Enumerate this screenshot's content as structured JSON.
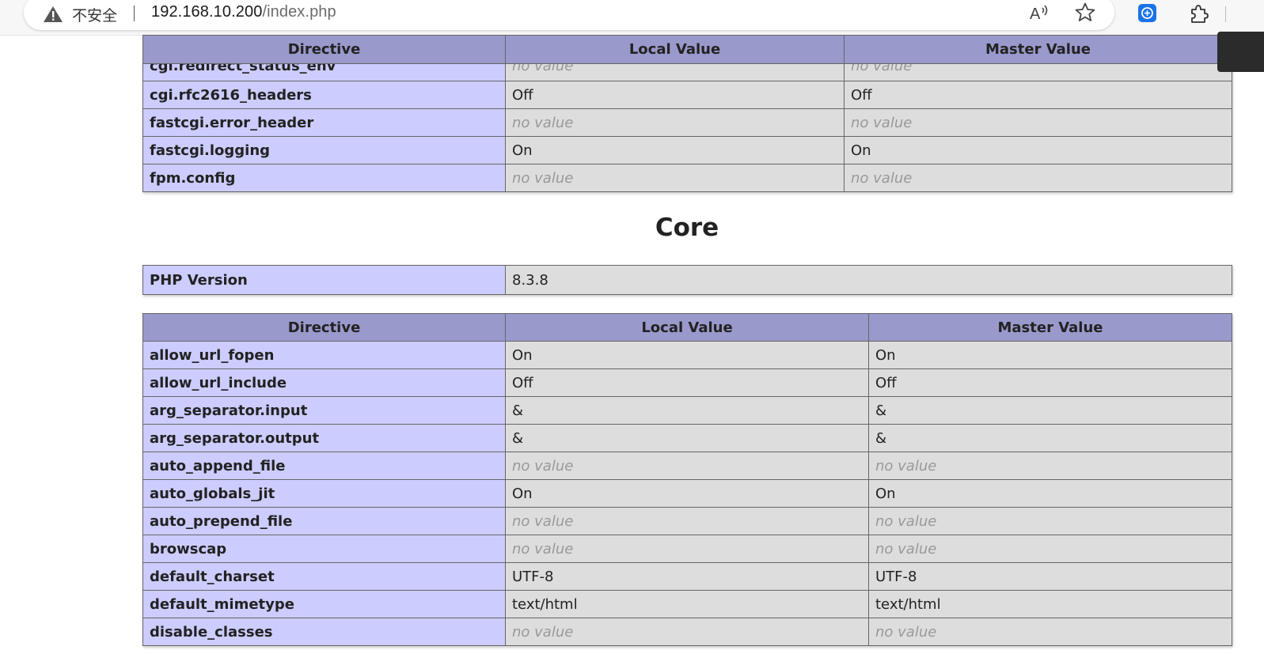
{
  "browser": {
    "insecure_label": "不安全",
    "url_host": "192.168.10.200",
    "url_path": "/index.php",
    "icons": [
      "warning-icon",
      "read-aloud-icon",
      "favorite-icon",
      "extension-translate-icon",
      "extensions-icon"
    ]
  },
  "top_table": {
    "headers": [
      "Directive",
      "Local Value",
      "Master Value"
    ],
    "rows": [
      {
        "name": "cgi.redirect_status_env",
        "local": "no value",
        "master": "no value"
      },
      {
        "name": "cgi.rfc2616_headers",
        "local": "Off",
        "master": "Off"
      },
      {
        "name": "fastcgi.error_header",
        "local": "no value",
        "master": "no value"
      },
      {
        "name": "fastcgi.logging",
        "local": "On",
        "master": "On"
      },
      {
        "name": "fpm.config",
        "local": "no value",
        "master": "no value"
      }
    ]
  },
  "core": {
    "title": "Core",
    "version_label": "PHP Version",
    "version_value": "8.3.8",
    "headers": [
      "Directive",
      "Local Value",
      "Master Value"
    ],
    "rows": [
      {
        "name": "allow_url_fopen",
        "local": "On",
        "master": "On"
      },
      {
        "name": "allow_url_include",
        "local": "Off",
        "master": "Off"
      },
      {
        "name": "arg_separator.input",
        "local": "&",
        "master": "&"
      },
      {
        "name": "arg_separator.output",
        "local": "&",
        "master": "&"
      },
      {
        "name": "auto_append_file",
        "local": "no value",
        "master": "no value"
      },
      {
        "name": "auto_globals_jit",
        "local": "On",
        "master": "On"
      },
      {
        "name": "auto_prepend_file",
        "local": "no value",
        "master": "no value"
      },
      {
        "name": "browscap",
        "local": "no value",
        "master": "no value"
      },
      {
        "name": "default_charset",
        "local": "UTF-8",
        "master": "UTF-8"
      },
      {
        "name": "default_mimetype",
        "local": "text/html",
        "master": "text/html"
      },
      {
        "name": "disable_classes",
        "local": "no value",
        "master": "no value"
      }
    ]
  },
  "colors": {
    "header_bg": "#9999cc",
    "directive_bg": "#ccccff",
    "value_bg": "#dddddd",
    "no_value_text": "#999999"
  }
}
